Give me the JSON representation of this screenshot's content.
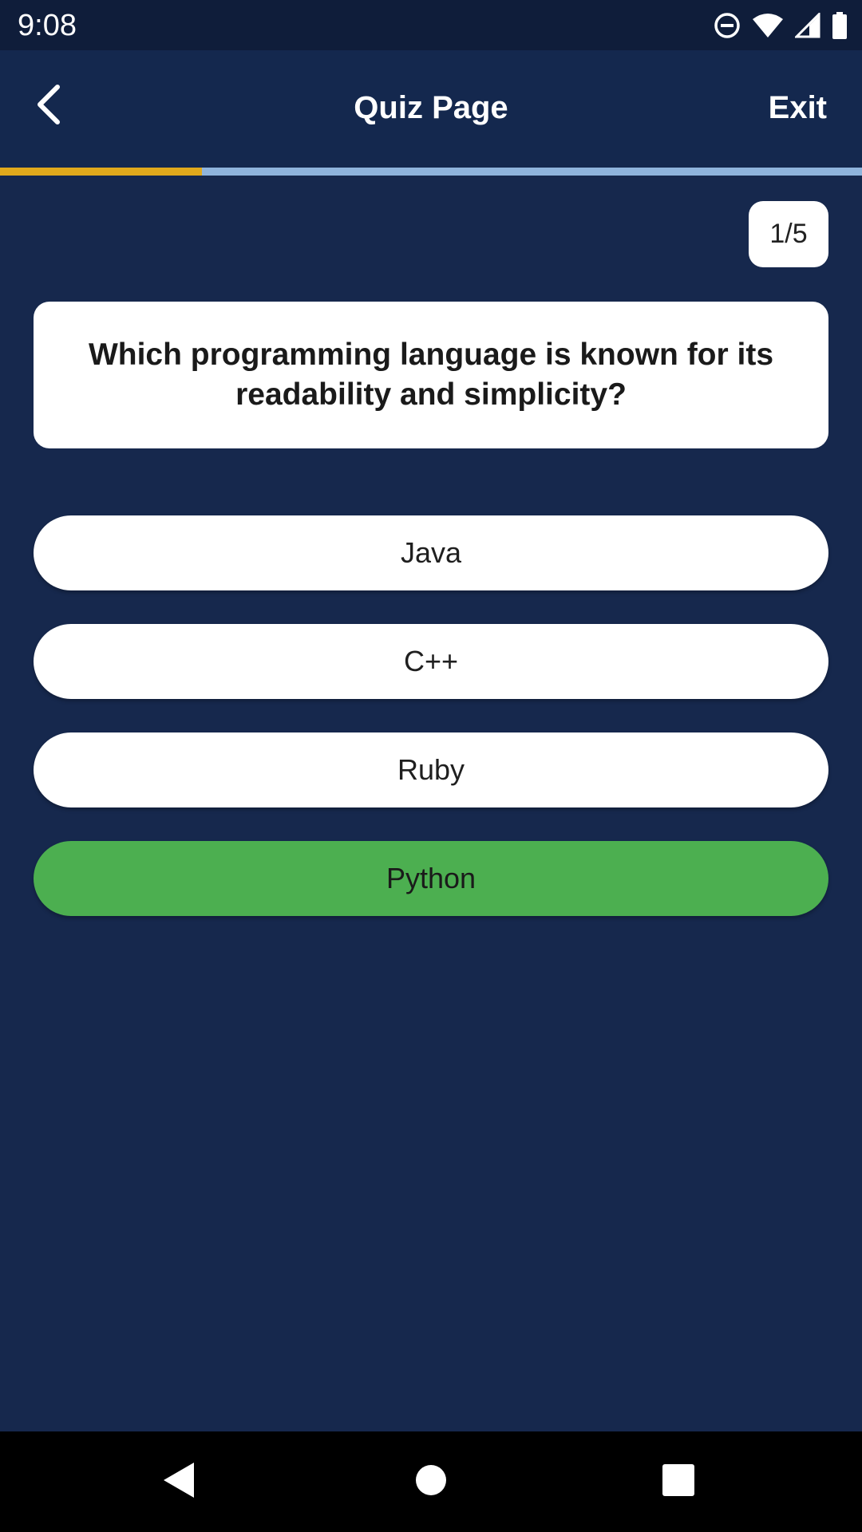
{
  "status_bar": {
    "time": "9:08",
    "icons": [
      "do-not-disturb-icon",
      "wifi-icon",
      "signal-icon",
      "battery-icon"
    ]
  },
  "app_bar": {
    "title": "Quiz Page",
    "exit_label": "Exit",
    "back_icon": "chevron-left-icon"
  },
  "progress": {
    "fraction": 0.234,
    "fill_color": "#e0a91c",
    "track_color": "#8fb4dc"
  },
  "quiz": {
    "counter": "1/5",
    "question": "Which programming language is known for its readability and simplicity?",
    "answers": [
      {
        "label": "Java",
        "state": "default"
      },
      {
        "label": "C++",
        "state": "default"
      },
      {
        "label": "Ruby",
        "state": "default"
      },
      {
        "label": "Python",
        "state": "correct"
      }
    ]
  },
  "colors": {
    "background": "#16284d",
    "correct": "#4caf50",
    "card": "#ffffff"
  },
  "nav_bar": {
    "icons": [
      "back-triangle-icon",
      "home-circle-icon",
      "recents-square-icon"
    ]
  }
}
